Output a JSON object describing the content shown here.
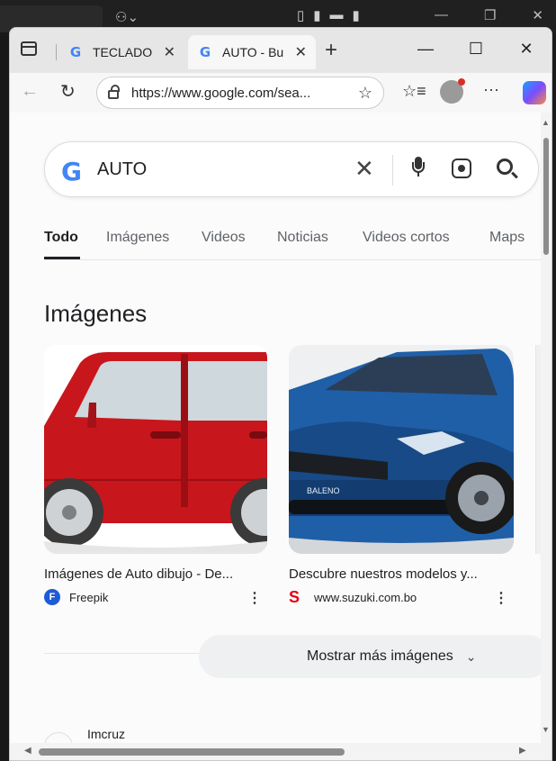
{
  "tabs": [
    {
      "title": "TECLADO"
    },
    {
      "title": "AUTO - Bu"
    }
  ],
  "window_controls": {
    "minimize": "—",
    "maximize": "☐",
    "close": "✕"
  },
  "address_bar": {
    "url": "https://www.google.com/sea..."
  },
  "search": {
    "query": "AUTO"
  },
  "nav_tabs": [
    "Todo",
    "Imágenes",
    "Videos",
    "Noticias",
    "Videos cortos",
    "Maps"
  ],
  "section": {
    "title": "Imágenes"
  },
  "image_results": [
    {
      "title": "Imágenes de Auto dibujo - De...",
      "source": "Freepik"
    },
    {
      "title": "Descubre nuestros modelos y...",
      "source": "www.suzuki.com.bo"
    }
  ],
  "more_images": {
    "label": "Mostrar más imágenes"
  },
  "next_result": {
    "name": "Imcruz"
  },
  "colors": {
    "google_blue": "#4285f4",
    "car_red": "#c8161d",
    "car_blue": "#1f5fa8"
  }
}
